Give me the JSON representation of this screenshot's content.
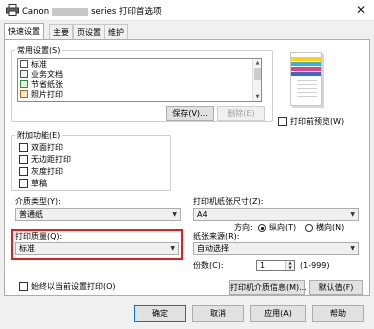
{
  "window": {
    "title_prefix": "Canon",
    "title_suffix": "series 打印首选项",
    "close_glyph": "✕"
  },
  "tabs": [
    {
      "label": "快速设置",
      "active": true
    },
    {
      "label": "主要",
      "active": false
    },
    {
      "label": "页设置",
      "active": false
    },
    {
      "label": "维护",
      "active": false
    }
  ],
  "common_settings": {
    "label": "常用设置(S)",
    "items": [
      "标准",
      "业务文档",
      "节省纸张",
      "照片打印"
    ],
    "save_button": "保存(V)...",
    "delete_button": "删除(E)"
  },
  "preview": {
    "checkbox_label": "打印前预览(W)",
    "checked": false
  },
  "additional_features": {
    "label": "附加功能(E)",
    "items": [
      {
        "label": "双面打印",
        "checked": false
      },
      {
        "label": "无边距打印",
        "checked": false
      },
      {
        "label": "灰度打印",
        "checked": false
      },
      {
        "label": "草稿",
        "checked": false
      }
    ]
  },
  "media_type": {
    "label": "介质类型(Y):",
    "value": "普通纸"
  },
  "printer_paper_size": {
    "label": "打印机纸张尺寸(Z):",
    "value": "A4"
  },
  "orientation": {
    "label": "方向:",
    "options": [
      {
        "label": "纵向(T)",
        "selected": true
      },
      {
        "label": "横向(N)",
        "selected": false
      }
    ]
  },
  "print_quality": {
    "label": "打印质量(Q):",
    "value": "标准"
  },
  "paper_source": {
    "label": "纸张来源(R):",
    "value": "自动选择"
  },
  "copies": {
    "label": "份数(C):",
    "value": "1",
    "range": "(1-999)"
  },
  "always_print": {
    "label": "始终以当前设置打印(O)",
    "checked": false
  },
  "buttons": {
    "media_info": "打印机介质信息(M)...",
    "defaults": "默认值(F)",
    "ok": "确定",
    "cancel": "取消",
    "apply": "应用(A)",
    "help": "帮助"
  },
  "colors": {
    "highlight": "#e02020",
    "accent": "#0078d7"
  }
}
